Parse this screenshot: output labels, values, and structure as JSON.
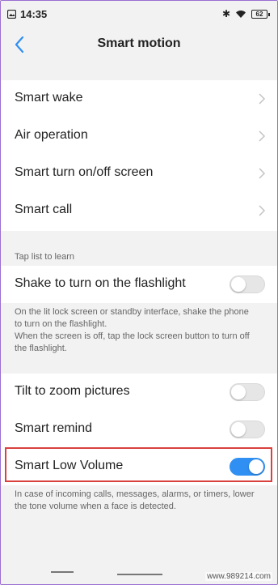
{
  "status_bar": {
    "time": "14:35",
    "battery": "62"
  },
  "header": {
    "title": "Smart motion"
  },
  "nav_rows": [
    {
      "label": "Smart wake"
    },
    {
      "label": "Air operation"
    },
    {
      "label": "Smart turn on/off screen"
    },
    {
      "label": "Smart call"
    }
  ],
  "section": {
    "label": "Tap list to learn"
  },
  "flashlight": {
    "label": "Shake to turn on the flashlight",
    "enabled": false,
    "description": "On the lit lock screen or standby interface, shake the phone to turn on the flashlight.\nWhen the screen is off, tap the lock screen button to turn off the flashlight."
  },
  "toggles": [
    {
      "label": "Tilt to zoom pictures",
      "enabled": false
    },
    {
      "label": "Smart remind",
      "enabled": false
    },
    {
      "label": "Smart Low Volume",
      "enabled": true
    }
  ],
  "low_volume_description": "In case of incoming calls, messages, alarms, or timers, lower the tone volume when a face is detected.",
  "watermark": "www.989214.com",
  "colors": {
    "accent": "#2f8ff2",
    "highlight": "#d9413e",
    "background": "#f2f2f2"
  }
}
